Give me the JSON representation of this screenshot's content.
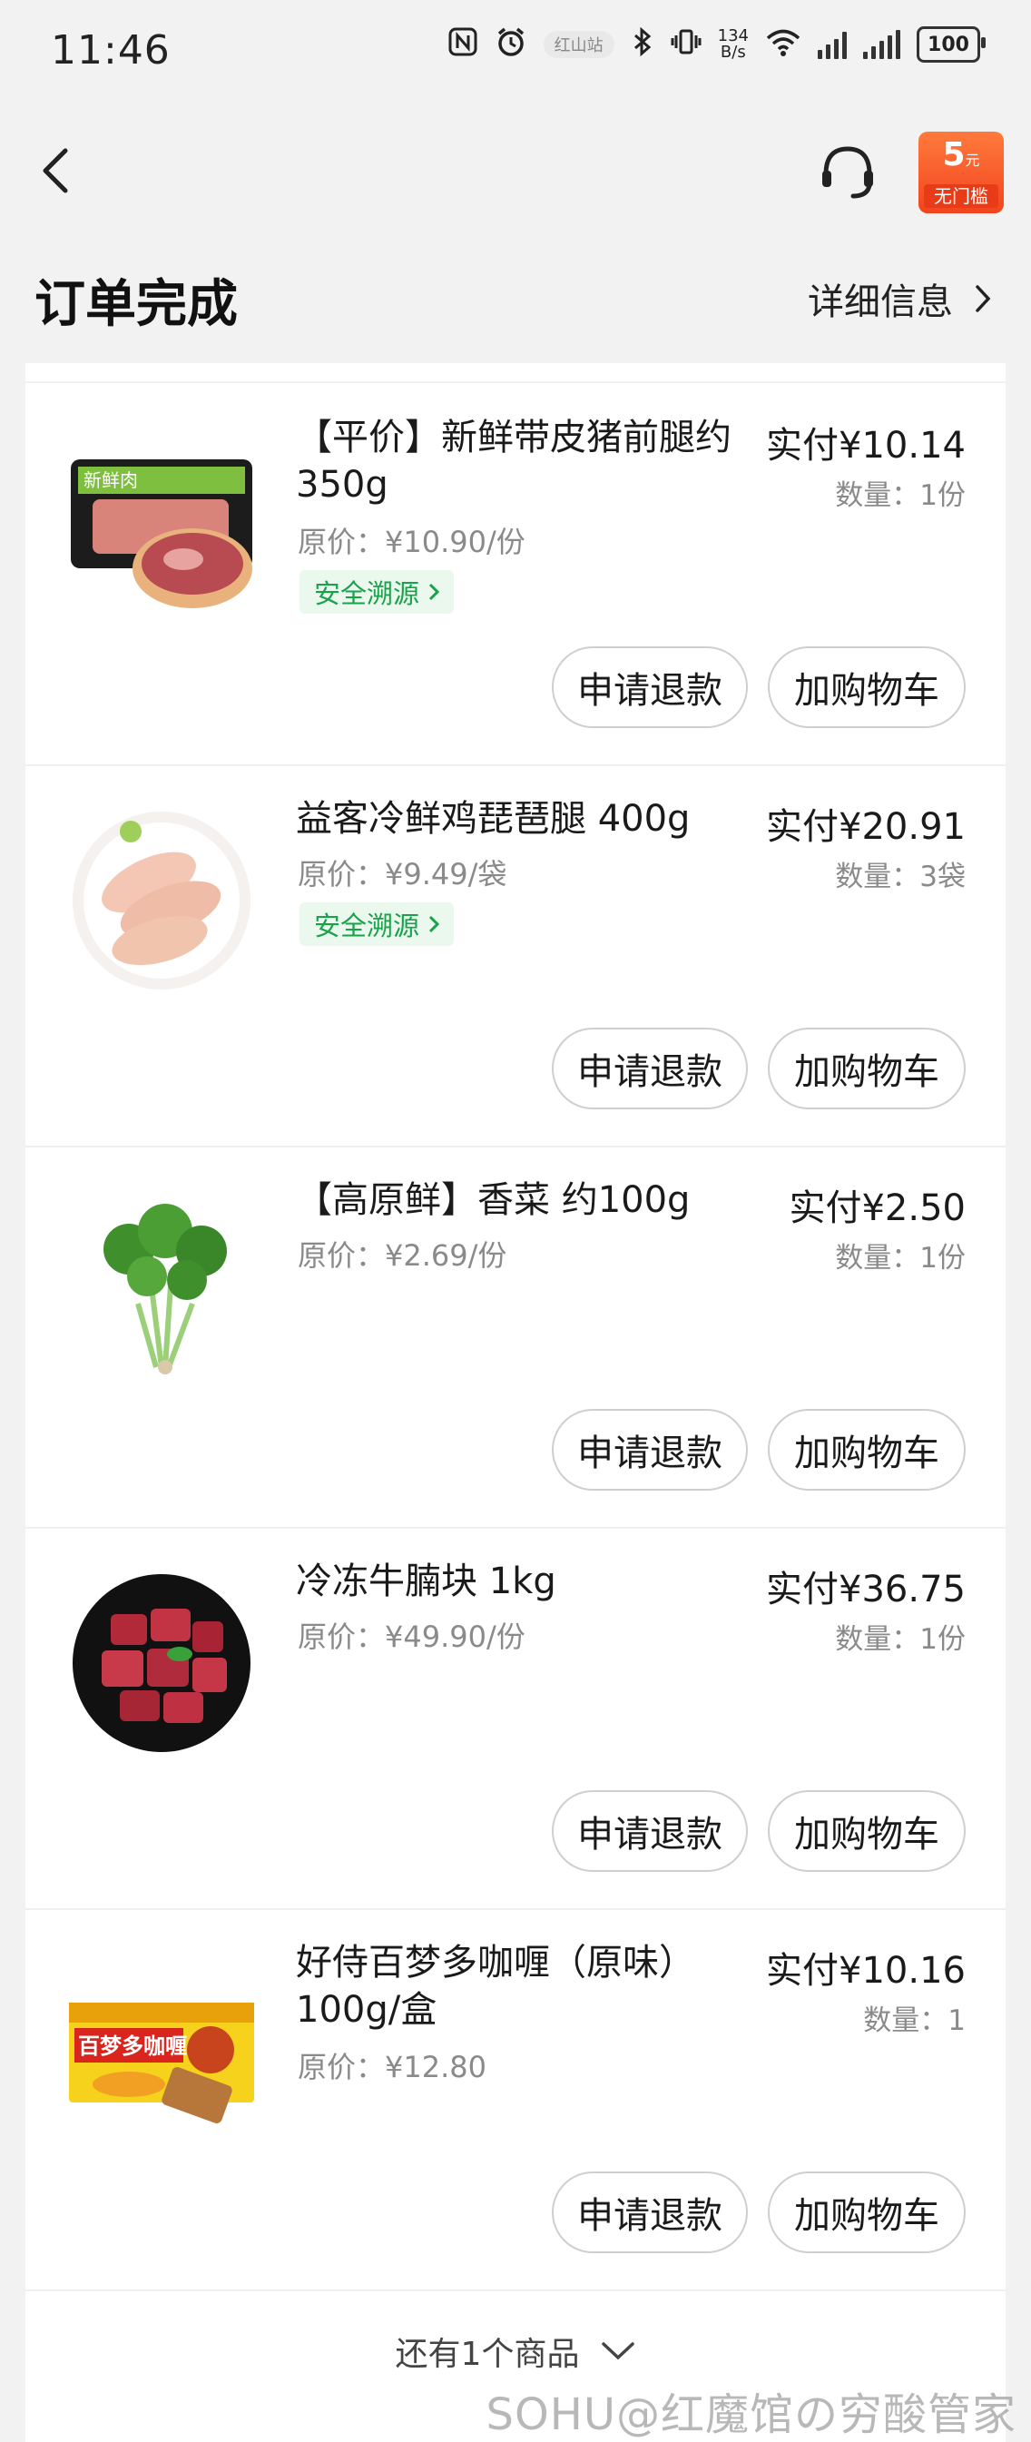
{
  "status_bar": {
    "time": "11:46",
    "carrier_tag": "红山站",
    "net_speed_value": "134",
    "net_speed_unit": "B/s",
    "battery": "100"
  },
  "nav": {
    "coupon_amount": "5",
    "coupon_unit": "元",
    "coupon_text": "无门槛"
  },
  "header": {
    "title": "订单完成",
    "detail_link": "详细信息"
  },
  "items": [
    {
      "name": "【平价】新鲜带皮猪前腿约350g",
      "original_price": "原价：¥10.90/份",
      "paid": "实付¥10.14",
      "quantity": "数量：1份",
      "trace": "安全溯源",
      "refund_button": "申请退款",
      "cart_button": "加购物车",
      "image_label": "新鲜肉"
    },
    {
      "name": "益客冷鲜鸡琵琶腿 400g",
      "original_price": "原价：¥9.49/袋",
      "paid": "实付¥20.91",
      "quantity": "数量：3袋",
      "trace": "安全溯源",
      "refund_button": "申请退款",
      "cart_button": "加购物车"
    },
    {
      "name": "【高原鲜】香菜 约100g",
      "original_price": "原价：¥2.69/份",
      "paid": "实付¥2.50",
      "quantity": "数量：1份",
      "refund_button": "申请退款",
      "cart_button": "加购物车"
    },
    {
      "name": "冷冻牛腩块 1kg",
      "original_price": "原价：¥49.90/份",
      "paid": "实付¥36.75",
      "quantity": "数量：1份",
      "refund_button": "申请退款",
      "cart_button": "加购物车"
    },
    {
      "name": "好侍百梦多咖喱（原味）100g/盒",
      "original_price": "原价：¥12.80",
      "paid": "实付¥10.16",
      "quantity": "数量：1",
      "refund_button": "申请退款",
      "cart_button": "加购物车",
      "image_label": "百梦多咖喱"
    }
  ],
  "more_items": "还有1个商品",
  "watermark": "SOHU@红魔馆の穷酸管家",
  "colors": {
    "accent_orange": "#f2441e",
    "trace_green": "#18a34a",
    "muted_gray": "#8a8a8a"
  }
}
